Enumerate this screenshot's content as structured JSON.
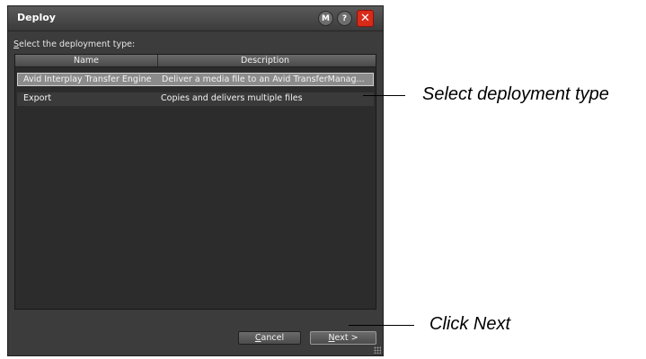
{
  "dialog": {
    "title": "Deploy",
    "buttons": {
      "m_label": "M",
      "help_label": "?",
      "close_label": "✕"
    },
    "prompt_mnemonic": "S",
    "prompt_rest": "elect the deployment type:",
    "columns": {
      "name": "Name",
      "description": "Description"
    },
    "rows": [
      {
        "name": "Avid Interplay Transfer Engine",
        "description": "Deliver a media file to an Avid TransferManag...",
        "selected": true
      },
      {
        "name": "Export",
        "description": "Copies and delivers multiple files",
        "selected": false
      }
    ],
    "cancel_mnemonic": "C",
    "cancel_rest": "ancel",
    "next_mnemonic": "N",
    "next_rest": "ext >"
  },
  "annotations": {
    "select_type": "Select deployment type",
    "click_next": "Click Next"
  }
}
